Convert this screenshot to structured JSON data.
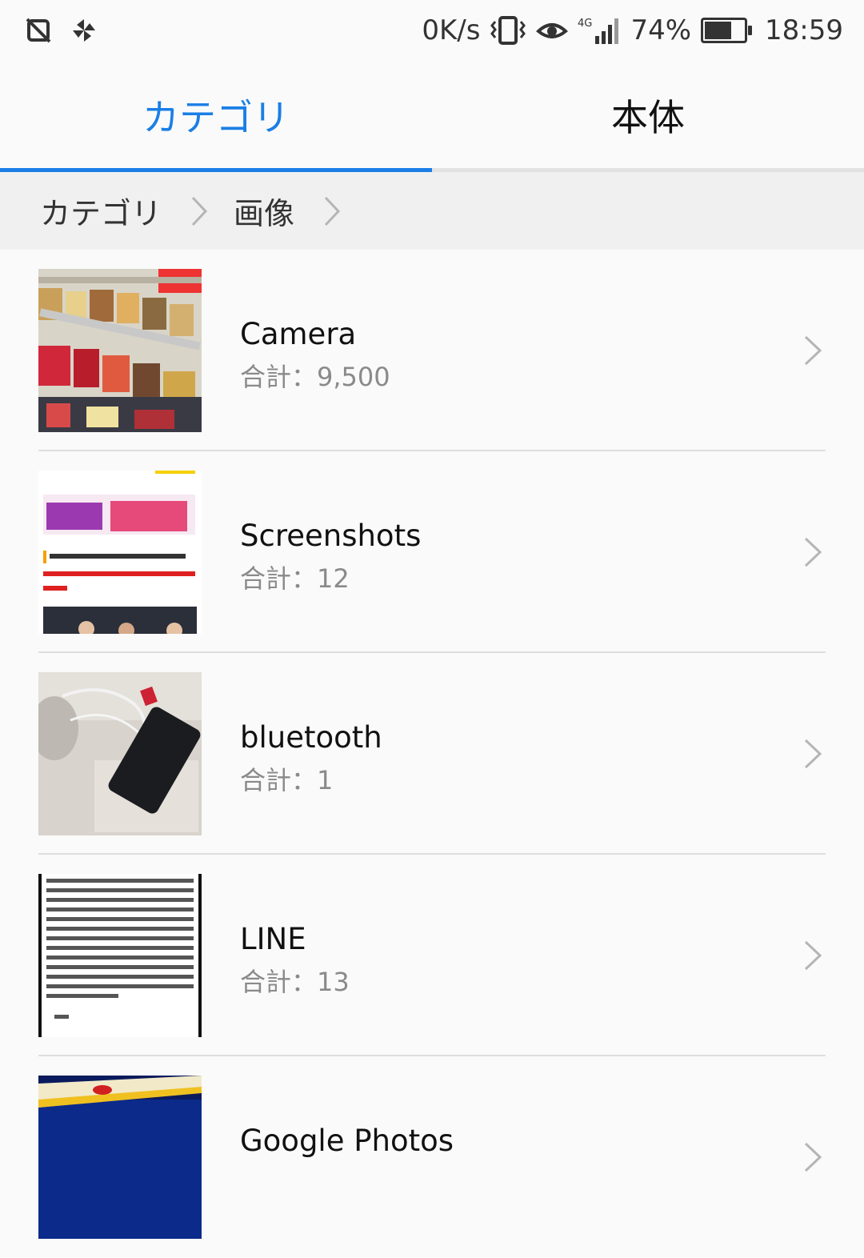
{
  "status_bar": {
    "speed": "0K/s",
    "network": "4G",
    "battery_percent": "74%",
    "battery_level": 0.74,
    "time": "18:59",
    "icons": [
      "no-sim-icon",
      "pinwheel-icon",
      "vibrate-icon",
      "eye-icon",
      "signal-icon",
      "battery-icon"
    ]
  },
  "tabs": [
    {
      "label": "カテゴリ",
      "active": true
    },
    {
      "label": "本体",
      "active": false
    }
  ],
  "breadcrumb": {
    "items": [
      "カテゴリ",
      "画像"
    ]
  },
  "albums": [
    {
      "name": "Camera",
      "count": "合計：9,500",
      "thumb": "store-shelf-photo"
    },
    {
      "name": "Screenshots",
      "count": "合計：12",
      "thumb": "tv-program-screenshot"
    },
    {
      "name": "bluetooth",
      "count": "合計：1",
      "thumb": "smartphone-photo"
    },
    {
      "name": "LINE",
      "count": "合計：13",
      "thumb": "text-document-screenshot"
    },
    {
      "name": "Google Photos",
      "count": "",
      "thumb": "blue-screen-photo"
    }
  ],
  "colors": {
    "accent": "#1a7ee6",
    "text": "#111111",
    "secondary_text": "#8a8a8a",
    "breadcrumb_bg": "#f0f0f0"
  }
}
